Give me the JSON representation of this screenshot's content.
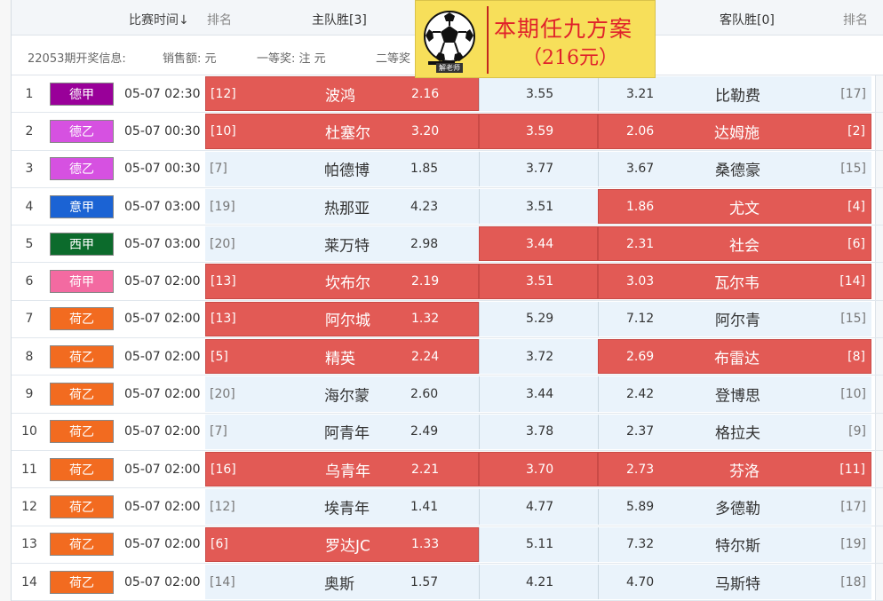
{
  "header": {
    "time": "比赛时间↓",
    "rank_home": "排名",
    "home": "主队胜[3]",
    "away": "客队胜[0]",
    "rank_away": "排名"
  },
  "info": {
    "period": "22053期开奖信息:",
    "sales": "销售额:   元",
    "first": "一等奖:   注   元",
    "second": "二等奖"
  },
  "promo": {
    "line1": "本期任九方案",
    "line2": "（216元）",
    "logo_text": "解老师"
  },
  "colors": {
    "highlight": "#e25a55",
    "cell_bg": "#eaf3fb",
    "promo_bg": "#f7df5a",
    "promo_text": "#e0212a"
  },
  "rows": [
    {
      "num": "1",
      "league": "德甲",
      "league_color": "#990099",
      "time": "05-07 02:30",
      "home_rank": "[12]",
      "home": "波鸿",
      "home_odd": "2.16",
      "draw_odd": "3.55",
      "away_odd": "3.21",
      "away": "比勒费",
      "away_rank": "[17]",
      "hl_home": true,
      "hl_draw": false,
      "hl_away": false
    },
    {
      "num": "2",
      "league": "德乙",
      "league_color": "#d651e1",
      "time": "05-07 00:30",
      "home_rank": "[10]",
      "home": "杜塞尔",
      "home_odd": "3.20",
      "draw_odd": "3.59",
      "away_odd": "2.06",
      "away": "达姆施",
      "away_rank": "[2]",
      "hl_home": true,
      "hl_draw": true,
      "hl_away": true
    },
    {
      "num": "3",
      "league": "德乙",
      "league_color": "#d651e1",
      "time": "05-07 00:30",
      "home_rank": "[7]",
      "home": "帕德博",
      "home_odd": "1.85",
      "draw_odd": "3.77",
      "away_odd": "3.67",
      "away": "桑德豪",
      "away_rank": "[15]",
      "hl_home": false,
      "hl_draw": false,
      "hl_away": false
    },
    {
      "num": "4",
      "league": "意甲",
      "league_color": "#1b63d4",
      "time": "05-07 03:00",
      "home_rank": "[19]",
      "home": "热那亚",
      "home_odd": "4.23",
      "draw_odd": "3.51",
      "away_odd": "1.86",
      "away": "尤文",
      "away_rank": "[4]",
      "hl_home": false,
      "hl_draw": false,
      "hl_away": true
    },
    {
      "num": "5",
      "league": "西甲",
      "league_color": "#0c6b2c",
      "time": "05-07 03:00",
      "home_rank": "[20]",
      "home": "莱万特",
      "home_odd": "2.98",
      "draw_odd": "3.44",
      "away_odd": "2.31",
      "away": "社会",
      "away_rank": "[6]",
      "hl_home": false,
      "hl_draw": true,
      "hl_away": true
    },
    {
      "num": "6",
      "league": "荷甲",
      "league_color": "#f36aa1",
      "time": "05-07 02:00",
      "home_rank": "[13]",
      "home": "坎布尔",
      "home_odd": "2.19",
      "draw_odd": "3.51",
      "away_odd": "3.03",
      "away": "瓦尔韦",
      "away_rank": "[14]",
      "hl_home": true,
      "hl_draw": true,
      "hl_away": true
    },
    {
      "num": "7",
      "league": "荷乙",
      "league_color": "#f26b20",
      "time": "05-07 02:00",
      "home_rank": "[13]",
      "home": "阿尔城",
      "home_odd": "1.32",
      "draw_odd": "5.29",
      "away_odd": "7.12",
      "away": "阿尔青",
      "away_rank": "[15]",
      "hl_home": true,
      "hl_draw": false,
      "hl_away": false
    },
    {
      "num": "8",
      "league": "荷乙",
      "league_color": "#f26b20",
      "time": "05-07 02:00",
      "home_rank": "[5]",
      "home": "精英",
      "home_odd": "2.24",
      "draw_odd": "3.72",
      "away_odd": "2.69",
      "away": "布雷达",
      "away_rank": "[8]",
      "hl_home": true,
      "hl_draw": false,
      "hl_away": true
    },
    {
      "num": "9",
      "league": "荷乙",
      "league_color": "#f26b20",
      "time": "05-07 02:00",
      "home_rank": "[20]",
      "home": "海尔蒙",
      "home_odd": "2.60",
      "draw_odd": "3.44",
      "away_odd": "2.42",
      "away": "登博思",
      "away_rank": "[10]",
      "hl_home": false,
      "hl_draw": false,
      "hl_away": false
    },
    {
      "num": "10",
      "league": "荷乙",
      "league_color": "#f26b20",
      "time": "05-07 02:00",
      "home_rank": "[7]",
      "home": "阿青年",
      "home_odd": "2.49",
      "draw_odd": "3.78",
      "away_odd": "2.37",
      "away": "格拉夫",
      "away_rank": "[9]",
      "hl_home": false,
      "hl_draw": false,
      "hl_away": false
    },
    {
      "num": "11",
      "league": "荷乙",
      "league_color": "#f26b20",
      "time": "05-07 02:00",
      "home_rank": "[16]",
      "home": "乌青年",
      "home_odd": "2.21",
      "draw_odd": "3.70",
      "away_odd": "2.73",
      "away": "芬洛",
      "away_rank": "[11]",
      "hl_home": true,
      "hl_draw": true,
      "hl_away": true
    },
    {
      "num": "12",
      "league": "荷乙",
      "league_color": "#f26b20",
      "time": "05-07 02:00",
      "home_rank": "[12]",
      "home": "埃青年",
      "home_odd": "1.41",
      "draw_odd": "4.77",
      "away_odd": "5.89",
      "away": "多德勒",
      "away_rank": "[17]",
      "hl_home": false,
      "hl_draw": false,
      "hl_away": false
    },
    {
      "num": "13",
      "league": "荷乙",
      "league_color": "#f26b20",
      "time": "05-07 02:00",
      "home_rank": "[6]",
      "home": "罗达JC",
      "home_odd": "1.33",
      "draw_odd": "5.11",
      "away_odd": "7.32",
      "away": "特尔斯",
      "away_rank": "[19]",
      "hl_home": true,
      "hl_draw": false,
      "hl_away": false
    },
    {
      "num": "14",
      "league": "荷乙",
      "league_color": "#f26b20",
      "time": "05-07 02:00",
      "home_rank": "[14]",
      "home": "奥斯",
      "home_odd": "1.57",
      "draw_odd": "4.21",
      "away_odd": "4.70",
      "away": "马斯特",
      "away_rank": "[18]",
      "hl_home": false,
      "hl_draw": false,
      "hl_away": false
    }
  ]
}
